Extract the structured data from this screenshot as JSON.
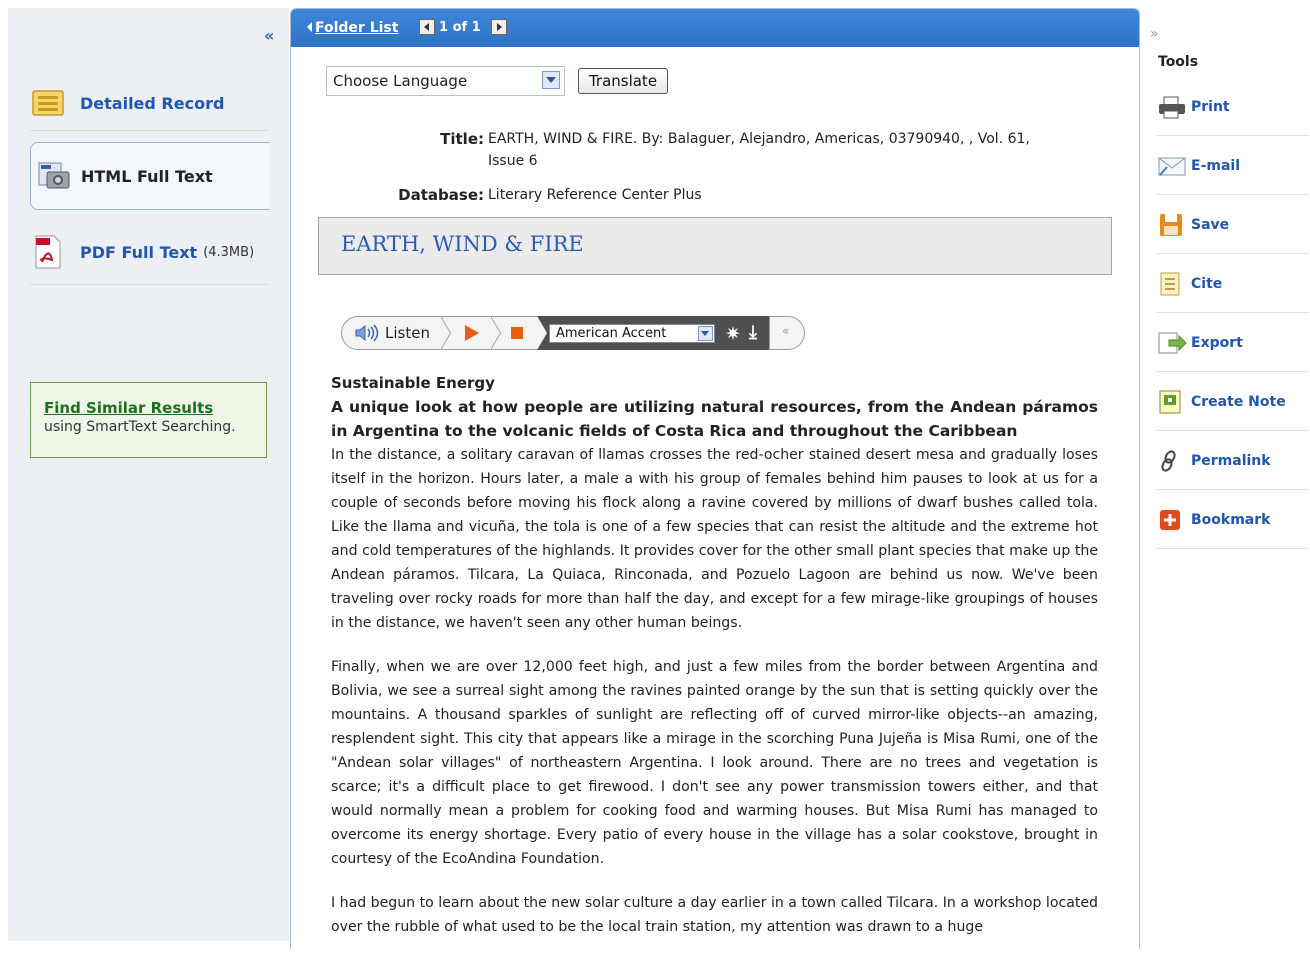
{
  "left_panel": {
    "collapse_label": "«",
    "items": [
      {
        "label": "Detailed Record",
        "icon": "detailed-record-icon"
      },
      {
        "label": "HTML Full Text",
        "icon": "html-full-text-icon"
      },
      {
        "label": "PDF Full Text",
        "extra": "(4.3MB)",
        "icon": "pdf-icon"
      }
    ],
    "find_similar": {
      "link": "Find Similar Results",
      "sub": "using SmartText Searching."
    }
  },
  "header": {
    "folder_list": "Folder List",
    "pager": "1 of 1"
  },
  "translate": {
    "language_select": "Choose Language",
    "button": "Translate"
  },
  "record": {
    "title_label": "Title:",
    "title_line1": "EARTH, WIND & FIRE. By: Balaguer, Alejandro, Americas, 03790940, , Vol. 61,",
    "title_line2": "Issue 6",
    "database_label": "Database:",
    "database_value": "Literary Reference Center Plus",
    "heading": "EARTH, WIND & FIRE"
  },
  "listen_bar": {
    "listen_label": "Listen",
    "accent": "American Accent",
    "collapse": "«"
  },
  "article": {
    "section": "Sustainable Energy",
    "subtitle": "A unique look at how people are utilizing natural resources, from the Andean páramos in Argentina to the volcanic fields of Costa Rica and throughout the Caribbean",
    "paragraphs": [
      "In the distance, a solitary caravan of llamas crosses the red-ocher stained desert mesa and gradually loses itself in the horizon. Hours later, a male a with his group of females behind him pauses to look at us for a couple of seconds before moving his flock along a ravine covered by millions of dwarf bushes called tola. Like the llama and vicuña, the tola is one of a few species that can resist the altitude and the extreme hot and cold temperatures of the highlands. It provides cover for the other small plant species that make up the Andean páramos. Tilcara, La Quiaca, Rinconada, and Pozuelo Lagoon are behind us now. We've been traveling over rocky roads for more than half the day, and except for a few mirage-like groupings of houses in the distance, we haven't seen any other human beings.",
      "Finally, when we are over 12,000 feet high, and just a few miles from the border between Argentina and Bolivia, we see a surreal sight among the ravines painted orange by the sun that is setting quickly over the mountains. A thousand sparkles of sunlight are reflecting off of curved mirror-like objects--an amazing, resplendent sight. This city that appears like a mirage in the scorching Puna Jujeña is Misa Rumi, one of the \"Andean solar villages\" of northeastern Argentina. I look around. There are no trees and vegetation is scarce; it's a difficult place to get firewood. I don't see any power transmission towers either, and that would normally mean a problem for cooking food and warming houses. But Misa Rumi has managed to overcome its energy shortage. Every patio of every house in the village has a solar cookstove, brought in courtesy of the EcoAndina Foundation.",
      "I had begun to learn about the new solar culture a day earlier in a town called Tilcara. In a workshop located over the rubble of what used to be the local train station, my attention was drawn to a huge"
    ]
  },
  "tools": {
    "expand_label": "»",
    "title": "Tools",
    "items": [
      {
        "label": "Print",
        "icon": "print-icon"
      },
      {
        "label": "E-mail",
        "icon": "email-icon"
      },
      {
        "label": "Save",
        "icon": "save-icon"
      },
      {
        "label": "Cite",
        "icon": "cite-icon"
      },
      {
        "label": "Export",
        "icon": "export-icon"
      },
      {
        "label": "Create Note",
        "icon": "create-note-icon"
      },
      {
        "label": "Permalink",
        "icon": "permalink-icon"
      },
      {
        "label": "Bookmark",
        "icon": "bookmark-icon"
      }
    ]
  },
  "colors": {
    "link_blue": "#1f57b0",
    "header_blue": "#3a7fd5",
    "orange": "#e85d10",
    "green_link": "#1e6f1e"
  }
}
